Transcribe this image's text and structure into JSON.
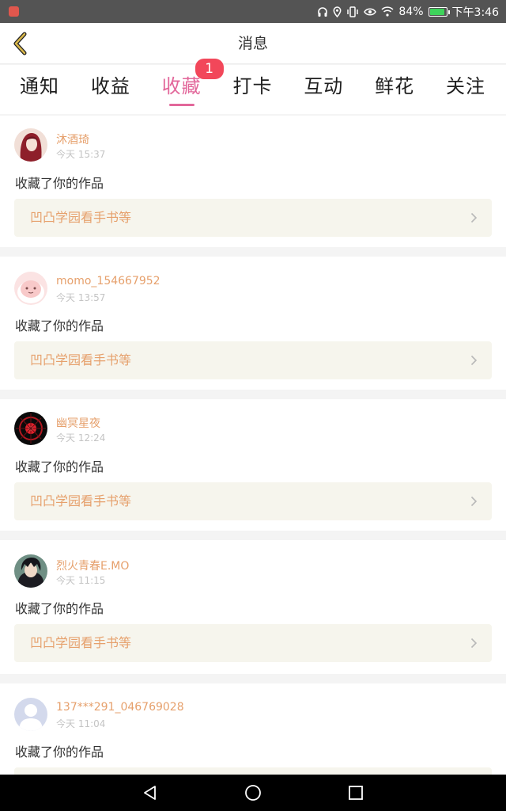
{
  "status_bar": {
    "battery_text": "84%",
    "time": "下午3:46"
  },
  "header": {
    "title": "消息"
  },
  "tabs": [
    {
      "label": "通知",
      "active": false
    },
    {
      "label": "收益",
      "active": false
    },
    {
      "label": "收藏",
      "active": true,
      "badge": "1"
    },
    {
      "label": "打卡",
      "active": false
    },
    {
      "label": "互动",
      "active": false
    },
    {
      "label": "鲜花",
      "active": false
    },
    {
      "label": "关注",
      "active": false
    }
  ],
  "messages": [
    {
      "username": "沐酒琦",
      "time": "今天 15:37",
      "action": "收藏了你的作品",
      "work": "凹凸学园看手书等"
    },
    {
      "username": "momo_154667952",
      "time": "今天 13:57",
      "action": "收藏了你的作品",
      "work": "凹凸学园看手书等"
    },
    {
      "username": "幽冥星夜",
      "time": "今天 12:24",
      "action": "收藏了你的作品",
      "work": "凹凸学园看手书等"
    },
    {
      "username": "烈火青春E.MO",
      "time": "今天 11:15",
      "action": "收藏了你的作品",
      "work": "凹凸学园看手书等"
    },
    {
      "username": "137***291_046769028",
      "time": "今天 11:04",
      "action": "收藏了你的作品",
      "work": ""
    }
  ],
  "colors": {
    "accent_pink": "#e2679a",
    "username_orange": "#e6a06c",
    "badge_red": "#f2475a",
    "back_arrow_yellow": "#d8b74a"
  }
}
